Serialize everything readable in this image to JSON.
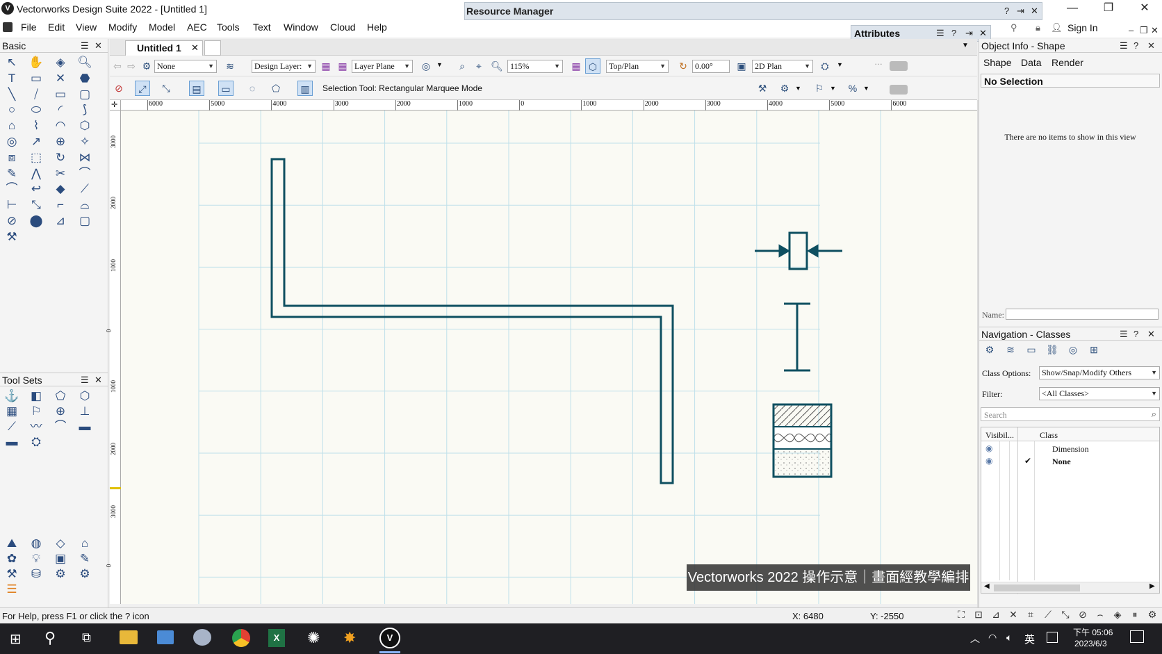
{
  "window": {
    "title": "Vectorworks Design Suite 2022 - [Untitled 1]"
  },
  "menu": [
    "File",
    "Edit",
    "View",
    "Modify",
    "Model",
    "AEC",
    "Tools",
    "Text",
    "Window",
    "Cloud",
    "Help"
  ],
  "resource_manager": {
    "title": "Resource Manager"
  },
  "attributes": {
    "title": "Attributes"
  },
  "sign_in": "Sign In",
  "document_tab": {
    "label": "Untitled 1"
  },
  "view_bar": {
    "class_value": "None",
    "layer_label": "Design Layer:",
    "plane": "Layer Plane",
    "zoom": "115%",
    "view": "Top/Plan",
    "rotation": "0.00°",
    "render_mode": "2D Plan"
  },
  "mode_bar": {
    "status_text": "Selection Tool: Rectangular Marquee Mode"
  },
  "basic_palette": {
    "title": "Basic"
  },
  "tool_sets": {
    "title": "Tool Sets"
  },
  "ruler": {
    "top_labels": [
      "6000",
      "5000",
      "4000",
      "3000",
      "2000",
      "1000",
      "0",
      "1000",
      "2000",
      "3000",
      "4000",
      "5000",
      "6000"
    ],
    "left_labels": [
      "3000",
      "2000",
      "1000",
      "0",
      "1000",
      "2000",
      "3000",
      "0"
    ]
  },
  "object_info": {
    "title": "Object Info - Shape",
    "tabs": [
      "Shape",
      "Data",
      "Render"
    ],
    "selection": "No Selection",
    "empty_message": "There are no items to show in this view",
    "name_label": "Name:"
  },
  "navigation": {
    "title": "Navigation - Classes",
    "class_options_label": "Class Options:",
    "class_options_value": "Show/Snap/Modify Others",
    "filter_label": "Filter:",
    "filter_value": "<All Classes>",
    "search_placeholder": "Search",
    "col_visibility": "Visibil...",
    "col_class": "Class",
    "rows": [
      {
        "name": "Dimension",
        "active": false
      },
      {
        "name": "None",
        "active": true
      }
    ]
  },
  "status": {
    "help": "For Help, press F1 or click the ? icon",
    "x": "X: 6480",
    "y": "Y: -2550"
  },
  "watermark": "Vectorworks 2022 操作示意｜畫面經教學編排",
  "taskbar": {
    "ime": "英",
    "time": "下午 05:06",
    "date": "2023/6/3"
  },
  "colors": {
    "drawing": "#0e4f60",
    "grid": "#bfe0ea",
    "canvas": "#fafaf4",
    "taskbar": "#1f1f23"
  }
}
